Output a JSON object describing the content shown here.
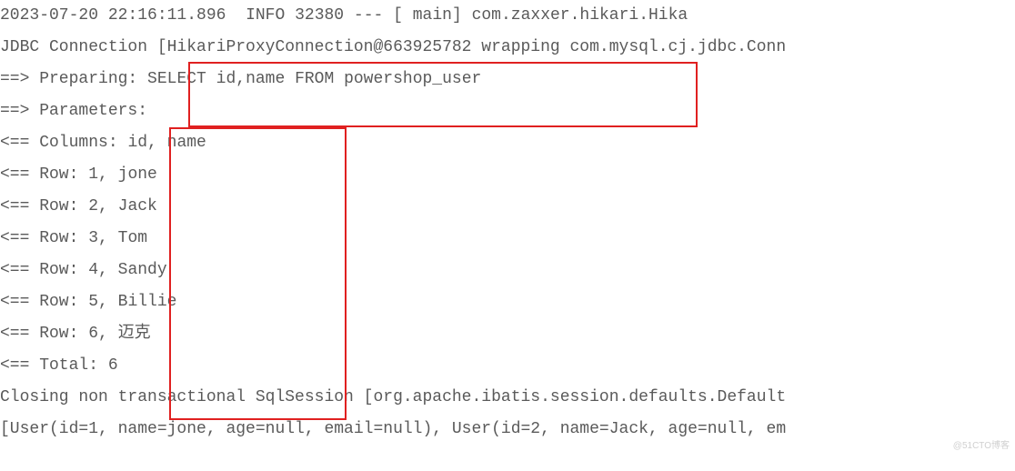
{
  "log": {
    "timestamp": "2023-07-20 22:16:11.896",
    "level": "INFO",
    "pid": "32380",
    "sep": "---",
    "thread": "[               main]",
    "logger": "com.zaxxer.hikari.Hika",
    "jdbc_line": "JDBC Connection [HikariProxyConnection@663925782 wrapping com.mysql.cj.jdbc.Conn",
    "preparing_label": "==>  Preparing:",
    "sql": "SELECT id,name FROM powershop_user",
    "parameters_label": "==> Parameters:",
    "parameters_value": "",
    "columns_label": "<==    Columns:",
    "columns_value": "id, name",
    "rows_label": "<==        Row:",
    "rows": [
      "1, jone",
      "2, Jack",
      "3, Tom",
      "4, Sandy",
      "5, Billie",
      "6, 迈克"
    ],
    "total_label": "<==      Total:",
    "total_value": "6",
    "closing_line": "Closing non transactional SqlSession [org.apache.ibatis.session.defaults.Default",
    "user_line": "[User(id=1, name=jone, age=null, email=null), User(id=2, name=Jack, age=null, em"
  },
  "watermark": "@51CTO博客"
}
